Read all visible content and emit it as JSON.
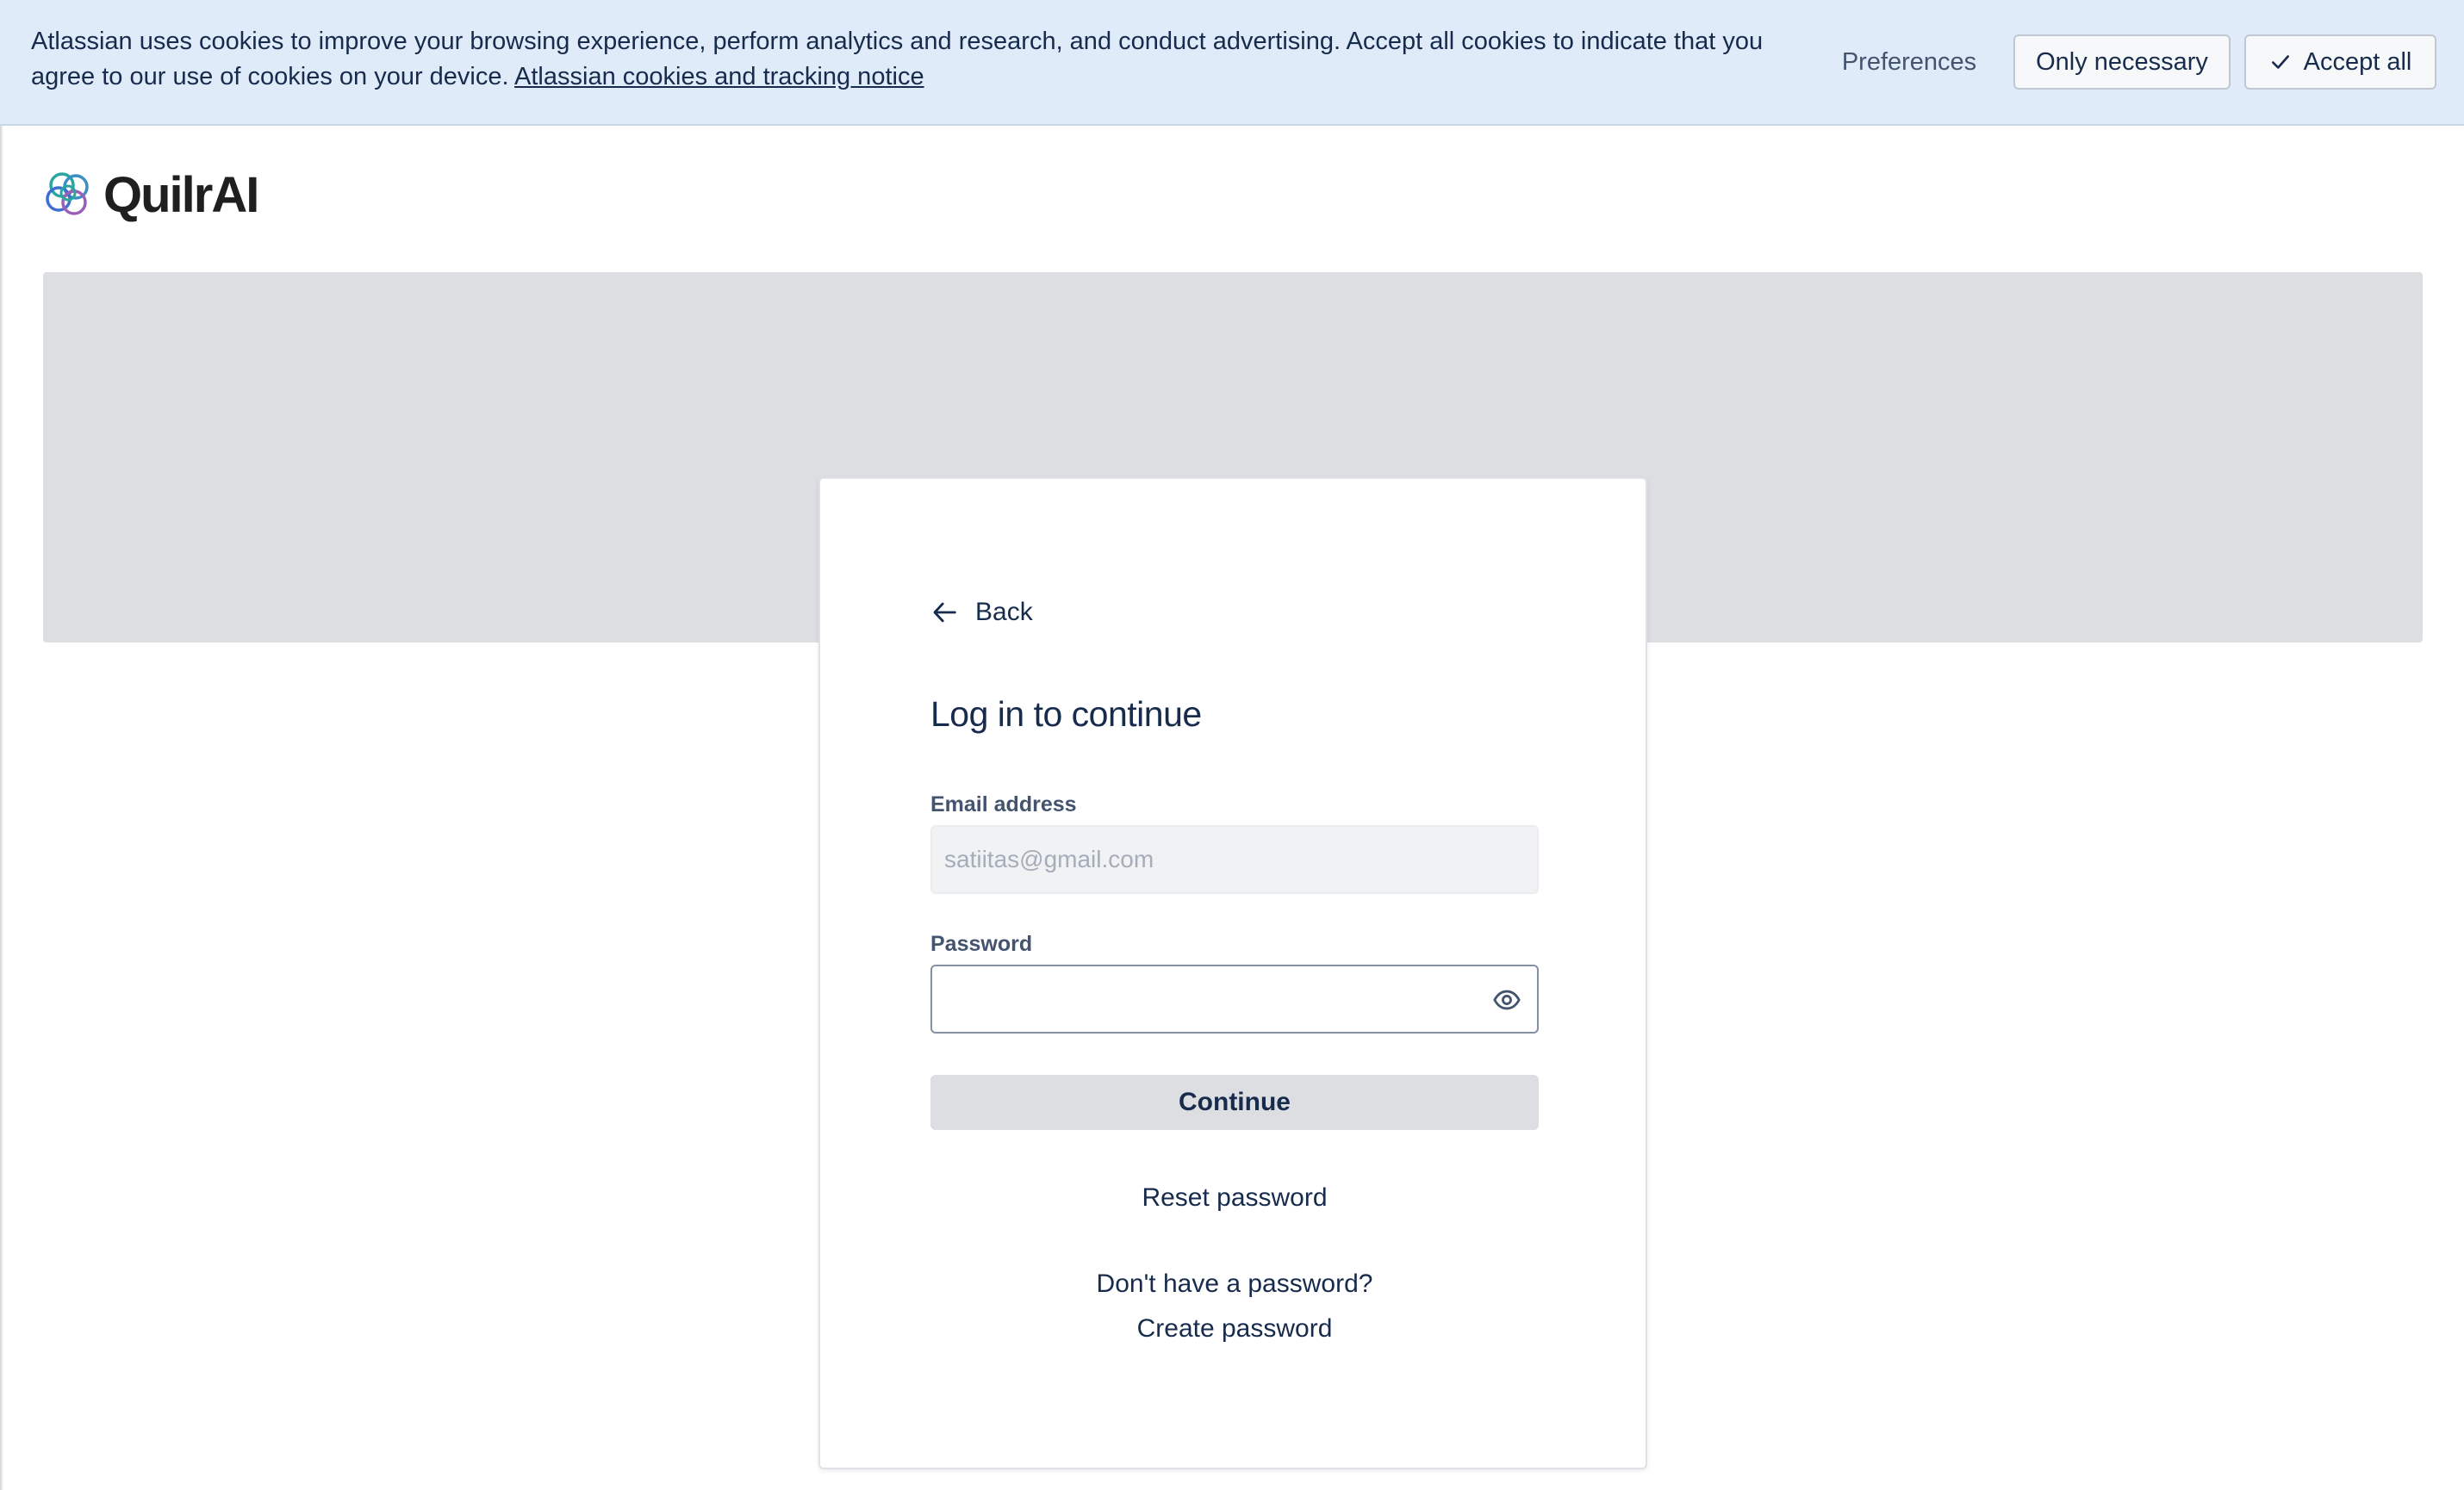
{
  "cookie_banner": {
    "text": "Atlassian uses cookies to improve your browsing experience, perform analytics and research, and conduct advertising. Accept all cookies to indicate that you agree to our use of cookies on your device.",
    "link_text": "Atlassian cookies and tracking notice",
    "preferences_label": "Preferences",
    "only_necessary_label": "Only necessary",
    "accept_all_label": "Accept all"
  },
  "brand": {
    "name": "QuilrAI",
    "colors": {
      "teal": "#2aa6a0",
      "blue": "#3c6fd1",
      "purple": "#9b5fb8"
    }
  },
  "login": {
    "back_label": "Back",
    "title": "Log in to continue",
    "email_label": "Email address",
    "email_placeholder": "satiitas@gmail.com",
    "password_label": "Password",
    "password_value": "",
    "continue_label": "Continue",
    "reset_label": "Reset password",
    "no_password_text": "Don't have a password?",
    "create_label": "Create password"
  },
  "icons": {
    "back": "arrow-left-icon",
    "eye": "eye-icon",
    "check": "check-icon"
  }
}
